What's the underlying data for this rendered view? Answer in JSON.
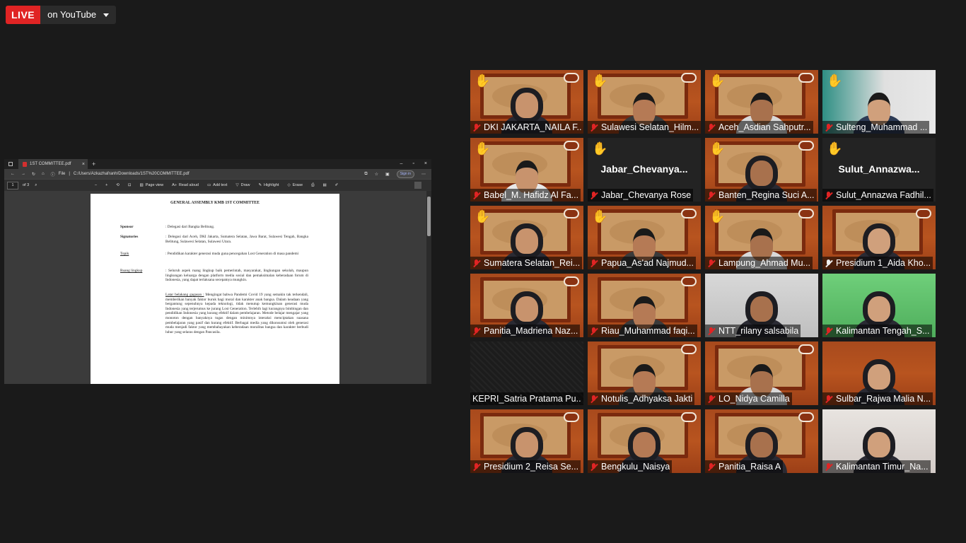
{
  "live": {
    "label": "LIVE",
    "destination": "on YouTube"
  },
  "browser": {
    "tab_title": "1ST COMMITTEE.pdf",
    "tab_close": "×",
    "new_tab": "+",
    "window_min": "–",
    "window_max": "▫",
    "window_close": "×",
    "address_scheme": "File",
    "address_url": "C:/Users/Azkazhafranh/Downloads/1ST%20COMMITTEE.pdf",
    "sign_in": "Sign in"
  },
  "pdf_toolbar": {
    "page_number": "1",
    "page_total": "of 3",
    "zoom_out": "–",
    "zoom_in": "+",
    "page_view": "Page view",
    "read_aloud": "Read aloud",
    "add_text": "Add text",
    "draw": "Draw",
    "highlight": "Highlight",
    "erase": "Erase"
  },
  "document": {
    "title": "GENERAL ASSEMBLY KMB 1ST COMMITTEE",
    "sponsor_label": "Sponsor",
    "sponsor_value": ": Delegasi dari Bangka Belitung.",
    "signatories_label": "Signatories",
    "signatories_value": ": Delegasi dari Aceh, DKI Jakarta, Sumatera Selatan, Jawa Barat, Sulawesi Tengah, Bangka Belitung, Sulawesi Selatan, Sulawesi Utara.",
    "topik_label": "Topik",
    "topik_value": ": Pendidikan karakter generasi muda guna pencegahan Lost Generation di masa pandemi",
    "ruang_label": "Ruang lingkup",
    "ruang_value": ": Seluruh aspek ruang lingkup baik pemerintah, masyarakat, lingkungan sekolah, maupun lingkungan keluarga dengan platform media sosial dan pemaksimalan keberadaan forum di Indonesia, yang dapat terlaksana secepatnya mungkin.",
    "latar_label": "Latar belakang gagasan :",
    "latar_value": "Mengingat bahwa Pandemi Covid 19 yang semakin tak terkendali, memberikan banyak faktor buruk bagi moral dan karakter anak bangsa. Dalam keadaan yang bergantung sepenuhnya kepada teknologi, tidak menutup kemungkinan generasi muda Indonesia yang terjerumus ke jurang Lost Generation. Terlebih lagi kurangnya bimbingan dan pendidikan Indonesia yang kurang efektif dalam pembelajaran. Metode belajar mengajar yang monoton dengan banyaknya tugas dengan minimnya interaksi menciptakan suasana pembelajaran yang pasif dan kurang efektif. Berbagai media yang dikonsumsi oleh generasi muda menjadi faktor yang membahayakan keberadaan moralitas bangsa dan karakter berbudi luhur yang selaras dengan Pancasila."
  },
  "participants": [
    {
      "name": "DKI JAKARTA_NAILA F...",
      "hand": true
    },
    {
      "name": "Sulawesi Selatan_Hilm...",
      "hand": true
    },
    {
      "name": "Aceh_Asdian Sahputr...",
      "hand": true
    },
    {
      "name": "Sulteng_Muhammad ...",
      "hand": true
    },
    {
      "name": "Babel_M. Hafidz Al Fa...",
      "hand": true
    },
    {
      "name": "Jabar_Chevanya Rose",
      "display_name": "Jabar_Chevanya...",
      "hand": true
    },
    {
      "name": "Banten_Regina Suci A...",
      "hand": true
    },
    {
      "name": "Sulut_Annazwa Fadhil...",
      "display_name": "Sulut_Annazwa...",
      "hand": true
    },
    {
      "name": "Sumatera Selatan_Rei...",
      "hand": true
    },
    {
      "name": "Papua_As'ad Najmud...",
      "hand": true
    },
    {
      "name": "Lampung_Ahmad Mu...",
      "hand": true
    },
    {
      "name": "Presidium 1_Aida Kho..."
    },
    {
      "name": "Panitia_Madriena Naz..."
    },
    {
      "name": "Riau_Muhammad faqi..."
    },
    {
      "name": "NTT_rilany salsabila"
    },
    {
      "name": "Kalimantan Tengah_S..."
    },
    {
      "name": "KEPRI_Satria Pratama Pu..."
    },
    {
      "name": "Notulis_Adhyaksa Jakti"
    },
    {
      "name": "LO_Nidya Camilla"
    },
    {
      "name": "Sulbar_Rajwa Malia N..."
    },
    {
      "name": "Presidium 2_Reisa Se..."
    },
    {
      "name": "Bengkulu_Naisya"
    },
    {
      "name": "Panitia_Raisa A"
    },
    {
      "name": "Kalimantan Timur_Na..."
    }
  ],
  "icons": {
    "hand": "raised-hand-icon",
    "mic": "muted-mic-icon",
    "pin": "pin-icon"
  },
  "colors": {
    "live": "#e02424",
    "speaking_border": "#e6e04a",
    "hand": "#f5c518",
    "muted": "#e02424"
  }
}
